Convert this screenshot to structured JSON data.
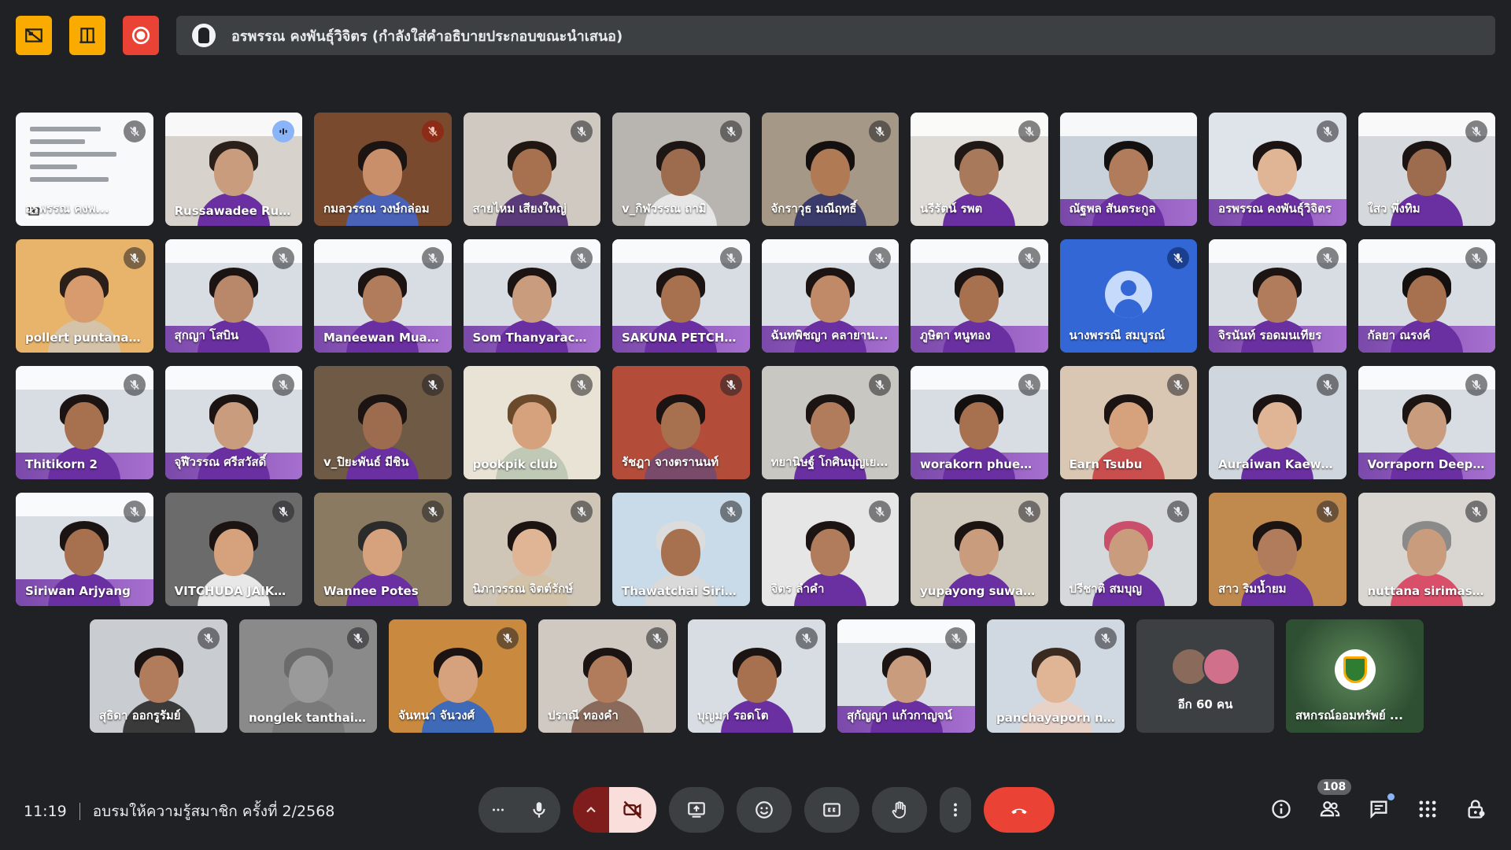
{
  "top": {
    "buttons": [
      {
        "name": "layout-icon",
        "color": "#f9ab00"
      },
      {
        "name": "present-view-icon",
        "color": "#f9ab00"
      },
      {
        "name": "record-icon",
        "color": "#ea4335"
      }
    ],
    "presenter_text": "อรพรรณ คงพันธุ์วิจิตร (กำลังใส่คำอธิบายประกอบขณะนำเสนอ)"
  },
  "rows": [
    [
      {
        "type": "doc",
        "name": "อรพรรณ คงพ...",
        "mic": "muted"
      },
      {
        "type": "person",
        "name": "Russawadee Rus...",
        "mic": "speaking",
        "active": true,
        "bg": "#d7d2cc",
        "skin": "#c99c7d",
        "hair": "#2b1f1a",
        "shirt": "#6a2fa0",
        "banner": true
      },
      {
        "type": "person",
        "name": "กมลวรรณ วงษ์กล่อม",
        "mic": "muted-red",
        "bg": "#7a4a2e",
        "skin": "#c98f6a",
        "hair": "#1b1412",
        "shirt": "#4a63b8"
      },
      {
        "type": "person",
        "name": "สายไหม เสียงใหญ่",
        "mic": "muted",
        "bg": "#cfc9c1",
        "skin": "#a7714f",
        "hair": "#201713",
        "shirt": "#5b3a7a"
      },
      {
        "type": "person",
        "name": "v_กิฬวรรณ ถามิ",
        "mic": "muted",
        "bg": "#b8b5b0",
        "skin": "#9d6b4d",
        "hair": "#1d1614",
        "shirt": "#e6e6e6"
      },
      {
        "type": "person",
        "name": "จักราวุธ มณีฤทธิ์",
        "mic": "muted",
        "bg": "#a69886",
        "skin": "#b07a55",
        "hair": "#141010",
        "shirt": "#3b3b6b"
      },
      {
        "type": "person",
        "name": "นรีรัตน์ รพต",
        "mic": "muted",
        "bg": "#dedbd6",
        "skin": "#a8795a",
        "hair": "#1f1815",
        "shirt": "#6a2fa0",
        "banner": true
      },
      {
        "type": "person",
        "name": "ณัฐพล สันตระกูล",
        "mic": "none",
        "bg": "#c9d1da",
        "skin": "#b07c5b",
        "hair": "#141010",
        "shirt": "#6a2fa0",
        "banner": true,
        "purple": true
      },
      {
        "type": "person",
        "name": "อรพรรณ คงพันธุ์วิจิตร",
        "mic": "muted",
        "bg": "#dfe3ea",
        "skin": "#e0b596",
        "hair": "#1b1412",
        "shirt": "#6a2fa0",
        "purple": true
      },
      {
        "type": "person",
        "name": "ใสว พึ่งทิม",
        "mic": "muted",
        "bg": "#d5d8dc",
        "skin": "#9d6b4d",
        "hair": "#1b1412",
        "shirt": "#6a2fa0",
        "banner": true
      }
    ],
    [
      {
        "type": "person",
        "name": "pollert puntanakul",
        "mic": "muted",
        "bg": "#e8b36a",
        "skin": "#d79b6e",
        "hair": "#2b1f1a",
        "shirt": "#d4c3a8"
      },
      {
        "type": "person",
        "name": "สุกญา โสบิน",
        "mic": "muted",
        "bg": "#d8dde3",
        "skin": "#b9876a",
        "hair": "#1b1412",
        "shirt": "#6a2fa0",
        "banner": true,
        "purple": true
      },
      {
        "type": "person",
        "name": "Maneewan Muan...",
        "mic": "muted",
        "bg": "#d8dde3",
        "skin": "#b07c5b",
        "hair": "#1b1412",
        "shirt": "#6a2fa0",
        "banner": true,
        "purple": true
      },
      {
        "type": "person",
        "name": "Som Thanyarack ...",
        "mic": "muted",
        "bg": "#d8dde3",
        "skin": "#c99c7d",
        "hair": "#1b1412",
        "shirt": "#6a2fa0",
        "banner": true,
        "purple": true
      },
      {
        "type": "person",
        "name": "SAKUNA PETCHR...",
        "mic": "muted",
        "bg": "#d8dde3",
        "skin": "#a7714f",
        "hair": "#1b1412",
        "shirt": "#6a2fa0",
        "banner": true,
        "purple": true
      },
      {
        "type": "person",
        "name": "ฉันทพิชญา คลายาน...",
        "mic": "muted",
        "bg": "#d8dde3",
        "skin": "#c08a68",
        "hair": "#1b1412",
        "shirt": "#6a2fa0",
        "banner": true,
        "purple": true
      },
      {
        "type": "person",
        "name": "ภูษิตา หนูทอง",
        "mic": "muted",
        "bg": "#d8dde3",
        "skin": "#a7714f",
        "hair": "#1b1412",
        "shirt": "#6a2fa0",
        "banner": true,
        "purple": true
      },
      {
        "type": "avatar",
        "name": "นางพรรณี สมบูรณ์",
        "mic": "muted-blue"
      },
      {
        "type": "person",
        "name": "จิรนันท์ รอดมนเทียร",
        "mic": "muted",
        "bg": "#d8dde3",
        "skin": "#b07c5b",
        "hair": "#1b1412",
        "shirt": "#6a2fa0",
        "banner": true,
        "purple": true
      },
      {
        "type": "person",
        "name": "กัลยา ณรงค์",
        "mic": "muted",
        "bg": "#d8dde3",
        "skin": "#a7714f",
        "hair": "#141010",
        "shirt": "#6a2fa0",
        "banner": true,
        "purple": true
      }
    ],
    [
      {
        "type": "person",
        "name": "Thitikorn 2",
        "mic": "muted",
        "bg": "#d8dde3",
        "skin": "#a7714f",
        "hair": "#1b1412",
        "shirt": "#6a2fa0",
        "banner": true,
        "purple": true
      },
      {
        "type": "person",
        "name": "จุฬีวรรณ ศรีสวัสดิ์",
        "mic": "muted",
        "bg": "#d8dde3",
        "skin": "#c99c7d",
        "hair": "#1b1412",
        "shirt": "#6a2fa0",
        "banner": true,
        "purple": true
      },
      {
        "type": "person",
        "name": "v_ปิยะพันธ์ มีชิน",
        "mic": "muted",
        "bg": "#6e5a45",
        "skin": "#9d6b4d",
        "hair": "#1b1412",
        "shirt": "#6a2fa0"
      },
      {
        "type": "person",
        "name": "pookpik club",
        "mic": "muted",
        "bg": "#e9e3d6",
        "skin": "#d6a27d",
        "hair": "#6b4a2b",
        "shirt": "#bfc9b5"
      },
      {
        "type": "person",
        "name": "รัชฎา จางตรานนท์",
        "mic": "muted",
        "bg": "#b44c3a",
        "skin": "#a7714f",
        "hair": "#1b1412",
        "shirt": "#7a4a6a"
      },
      {
        "type": "person",
        "name": "ทยานิษฐ์ โกศินบุญเย...",
        "mic": "muted",
        "bg": "#c9c7c2",
        "skin": "#b07c5b",
        "hair": "#1b1412",
        "shirt": "#6a2fa0"
      },
      {
        "type": "person",
        "name": "worakorn phuen...",
        "mic": "muted",
        "bg": "#d8dde3",
        "skin": "#a7714f",
        "hair": "#141010",
        "shirt": "#6a2fa0",
        "banner": true,
        "purple": true
      },
      {
        "type": "person",
        "name": "Earn Tsubu",
        "mic": "muted",
        "bg": "#d9c7b3",
        "skin": "#d6a27d",
        "hair": "#1b1412",
        "shirt": "#c94f4f"
      },
      {
        "type": "person",
        "name": "Auraiwan Kaewta...",
        "mic": "muted",
        "bg": "#d0d6dd",
        "skin": "#e0b596",
        "hair": "#1b1412",
        "shirt": "#6a2fa0"
      },
      {
        "type": "person",
        "name": "Vorraporn Deepr...",
        "mic": "muted",
        "bg": "#d8dde3",
        "skin": "#c99c7d",
        "hair": "#1b1412",
        "shirt": "#6a2fa0",
        "banner": true,
        "purple": true
      }
    ],
    [
      {
        "type": "person",
        "name": "Siriwan Arjyang",
        "mic": "muted",
        "bg": "#d8dde3",
        "skin": "#a7714f",
        "hair": "#1b1412",
        "shirt": "#6a2fa0",
        "banner": true,
        "purple": true
      },
      {
        "type": "person",
        "name": "VITCHUDA JAIKU...",
        "mic": "muted",
        "bg": "#6b6b6b",
        "skin": "#d6a27d",
        "hair": "#1b1412",
        "shirt": "#e8e8e8"
      },
      {
        "type": "person",
        "name": "Wannee Potes",
        "mic": "muted",
        "bg": "#8b7a62",
        "skin": "#d6a27d",
        "hair": "#2b2b2b",
        "shirt": "#6a2fa0"
      },
      {
        "type": "person",
        "name": "นิภาวรรณ จิตต์รักษ์",
        "mic": "muted",
        "bg": "#cfc6b8",
        "skin": "#e0b596",
        "hair": "#1b1412",
        "shirt": "#d2c2a8"
      },
      {
        "type": "person",
        "name": "Thawatchai Sirim...",
        "mic": "muted",
        "bg": "#c9dbe8",
        "skin": "#a7714f",
        "hair": "#dcdcdc",
        "shirt": "#d9d9d9"
      },
      {
        "type": "person",
        "name": "จิตร ลำคำ",
        "mic": "muted",
        "bg": "#e6e6e6",
        "skin": "#b07c5b",
        "hair": "#1b1412",
        "shirt": "#6a2fa0"
      },
      {
        "type": "person",
        "name": "yupayong suwan...",
        "mic": "muted",
        "bg": "#cfc8bd",
        "skin": "#c99c7d",
        "hair": "#1b1412",
        "shirt": "#6a2fa0"
      },
      {
        "type": "person",
        "name": "ปรีชาติ สมบุญ",
        "mic": "muted",
        "bg": "#d6d9dc",
        "skin": "#c99c7d",
        "hair": "#c94f6a",
        "shirt": "#6a2fa0"
      },
      {
        "type": "person",
        "name": "สาว ริมน้ำยม",
        "mic": "muted",
        "bg": "#c08a4f",
        "skin": "#b07c5b",
        "hair": "#1b1412",
        "shirt": "#6a2fa0"
      },
      {
        "type": "person",
        "name": "nuttana sirimasa...",
        "mic": "muted",
        "bg": "#d9d6d1",
        "skin": "#c99c7d",
        "hair": "#8a8a8a",
        "shirt": "#d94f6a"
      }
    ],
    [
      {
        "type": "person",
        "name": "สุธิดา ออกรูรัมย์",
        "mic": "muted",
        "bg": "#c9cdd2",
        "skin": "#b07c5b",
        "hair": "#1b1412",
        "shirt": "#3a3a3a"
      },
      {
        "type": "person",
        "name": "nonglek tanthais...",
        "mic": "muted",
        "bg": "#8a8a8a",
        "skin": "#9a9a9a",
        "hair": "#6b6b6b",
        "shirt": "#7a7a7a"
      },
      {
        "type": "person",
        "name": "จันทนา จันวงศ์",
        "mic": "muted",
        "bg": "#c98a3f",
        "skin": "#d6a27d",
        "hair": "#1b1412",
        "shirt": "#3e6ab8"
      },
      {
        "type": "person",
        "name": "ปราณี ทองคำ",
        "mic": "muted",
        "bg": "#cfc9c1",
        "skin": "#b07c5b",
        "hair": "#1b1412",
        "shirt": "#8a6a5a"
      },
      {
        "type": "person",
        "name": "บุญมา รอดโต",
        "mic": "muted",
        "bg": "#d8dde3",
        "skin": "#a7714f",
        "hair": "#1b1412",
        "shirt": "#6a2fa0"
      },
      {
        "type": "person",
        "name": "สุกัญญา แก้วกาญจน์",
        "mic": "muted",
        "bg": "#d8dde3",
        "skin": "#c99c7d",
        "hair": "#1b1412",
        "shirt": "#6a2fa0",
        "banner": true,
        "purple": true
      },
      {
        "type": "person",
        "name": "panchayaporn na...",
        "mic": "muted",
        "bg": "#d0d8e2",
        "skin": "#e0b596",
        "hair": "#3b2a20",
        "shirt": "#e8d2c8"
      },
      {
        "type": "more",
        "name": "อีก 60 คน"
      },
      {
        "type": "logo",
        "name": "สหกรณ์ออมทรัพย์ ..."
      }
    ]
  ],
  "bottom": {
    "time": "11:19",
    "meeting_title": "อบรมให้ความรู้สมาชิก ครั้งที่ 2/2568",
    "participants_count": "108"
  },
  "colors": {
    "background": "#202124",
    "surface": "#3c4043",
    "end_call": "#ea4335",
    "accent": "#8ab4f8",
    "camera_off_bg": "#7f1d1d",
    "camera_off_active": "#f9dedc"
  }
}
